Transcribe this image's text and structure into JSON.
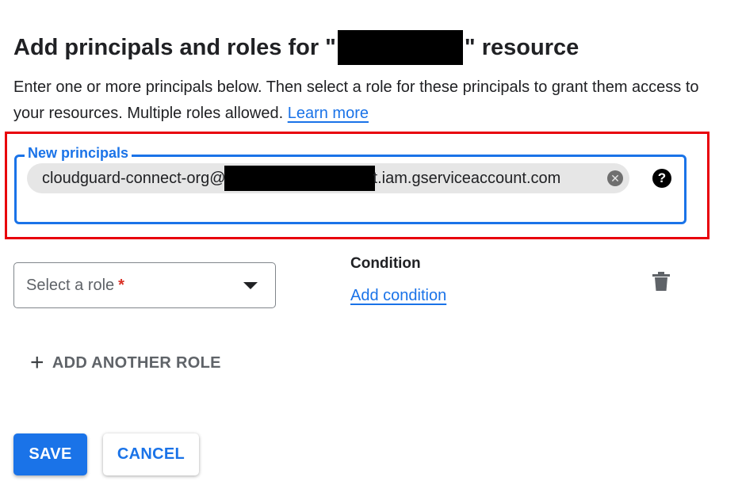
{
  "dialog": {
    "title_prefix": "Add principals and roles for \"",
    "title_suffix": "\" resource",
    "description": "Enter one or more principals below. Then select a role for these principals to grant them access to your resources. Multiple roles allowed.",
    "learn_more": "Learn more"
  },
  "principals": {
    "label": "New principals",
    "chip_prefix": "cloudguard-connect-org@",
    "chip_suffix": "t.iam.gserviceaccount.com",
    "remove_glyph": "✕",
    "help_glyph": "?"
  },
  "role": {
    "placeholder": "Select a role",
    "required_mark": "*"
  },
  "condition": {
    "heading": "Condition",
    "add_label": "Add condition"
  },
  "add_role": {
    "label": "ADD ANOTHER ROLE",
    "icon": "+"
  },
  "actions": {
    "save": "SAVE",
    "cancel": "CANCEL"
  },
  "colors": {
    "accent": "#1a73e8",
    "highlight": "#e8000b",
    "required": "#d93025"
  },
  "icons": [
    "cancel-circle-icon",
    "help-icon",
    "dropdown-arrow-icon",
    "trash-icon",
    "plus-icon"
  ]
}
